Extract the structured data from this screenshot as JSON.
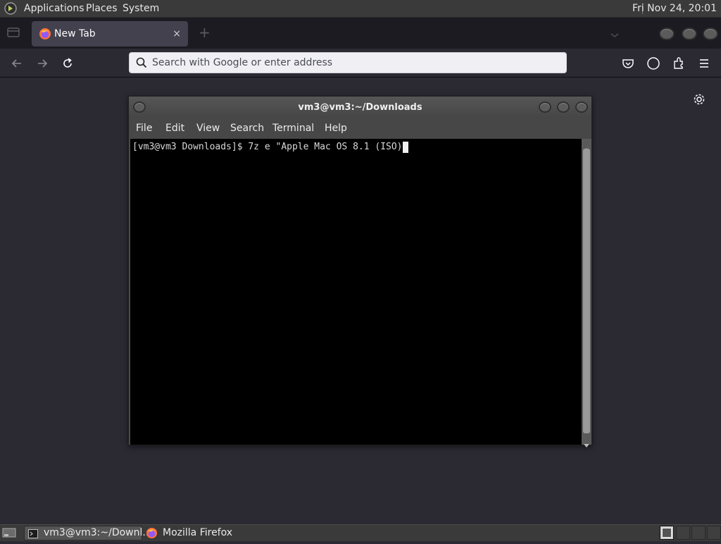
{
  "top_panel": {
    "menus": [
      "Applications",
      "Places",
      "System"
    ],
    "clock": "Fri Nov 24, 20:01"
  },
  "browser": {
    "tab_title": "New Tab",
    "tab_close": "×",
    "new_tab": "+",
    "url_placeholder": "Search with Google or enter address"
  },
  "terminal": {
    "title": "vm3@vm3:~/Downloads",
    "menus": [
      "File",
      "Edit",
      "View",
      "Search",
      "Terminal",
      "Help"
    ],
    "prompt_line": "[vm3@vm3 Downloads]$ 7z e \"Apple Mac OS 8.1 (ISO)"
  },
  "taskbar": {
    "items": [
      "vm3@vm3:~/Downl...",
      "Mozilla Firefox"
    ]
  },
  "colors": {
    "browser_bg": "#2b2a33",
    "panel_bg": "#3a3a3a",
    "terminal_bg": "#000000"
  }
}
